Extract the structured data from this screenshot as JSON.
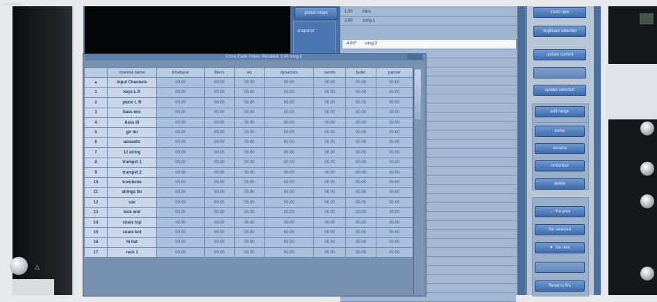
{
  "hardware": {
    "left_label": "Resolution"
  },
  "snapshot": {
    "global_button": "global snaps",
    "panel_label": "snapshot",
    "list": [
      {
        "time": "1.00",
        "name": "intro"
      },
      {
        "time": "2.00",
        "name": "song 1"
      },
      {
        "time": "4.00*",
        "name": "song 3"
      }
    ]
  },
  "buttons": {
    "insert_new": "insert new",
    "duplicate_selected": "duplicate selected",
    "update_current": "update current",
    "update_selected": "update selected",
    "edit_range": "edit range",
    "move": "move",
    "rename": "rename",
    "renumber": "renumber",
    "delete": "delete",
    "fire_prev": "fire prev",
    "fire_selected": "fire selected",
    "fire_next": "fire next",
    "reset_to_fire": "Reset to fire"
  },
  "dialog": {
    "title": "Cross Fade Times: Recalled: 2.00 song 2",
    "columns": [
      "channel name",
      "timebase",
      "filters",
      "eq",
      "dynamics",
      "sends",
      "fader",
      "panner"
    ],
    "rows": [
      {
        "idx": "▲",
        "name": "Input Channels"
      },
      {
        "idx": "1",
        "name": "keys L R"
      },
      {
        "idx": "2",
        "name": "piano L R"
      },
      {
        "idx": "3",
        "name": "bass mic"
      },
      {
        "idx": "4",
        "name": "bass di"
      },
      {
        "idx": "5",
        "name": "gtr tkr"
      },
      {
        "idx": "6",
        "name": "acoustic"
      },
      {
        "idx": "7",
        "name": "12 string"
      },
      {
        "idx": "8",
        "name": "trumpet 1"
      },
      {
        "idx": "9",
        "name": "trumpet 2"
      },
      {
        "idx": "10",
        "name": "trombone"
      },
      {
        "idx": "11",
        "name": "strings tkr"
      },
      {
        "idx": "12",
        "name": "sax"
      },
      {
        "idx": "13",
        "name": "kick end"
      },
      {
        "idx": "14",
        "name": "snare top"
      },
      {
        "idx": "15",
        "name": "snare bot"
      },
      {
        "idx": "16",
        "name": "hi hat"
      },
      {
        "idx": "17",
        "name": "rack 1"
      }
    ],
    "cell_value": "00.00"
  }
}
